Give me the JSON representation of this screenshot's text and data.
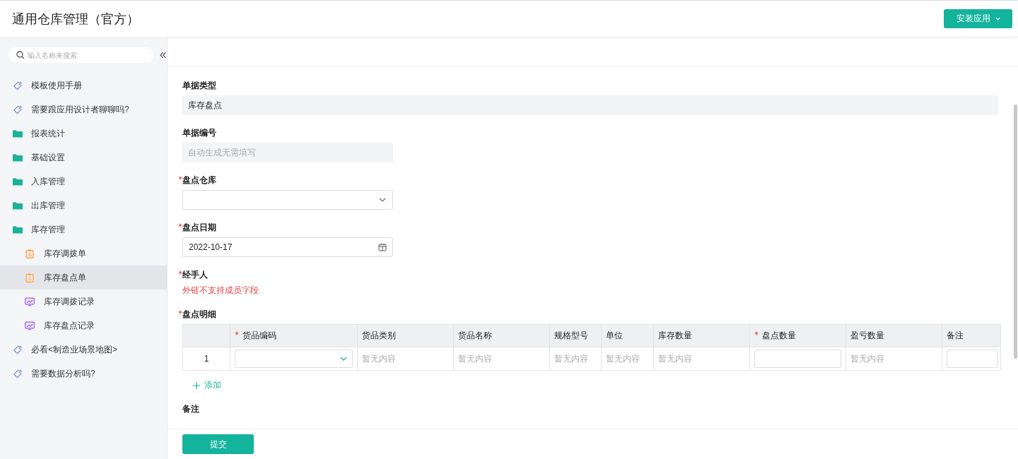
{
  "header": {
    "title": "通用仓库管理（官方）",
    "install_button": "安装应用"
  },
  "sidebar": {
    "search_placeholder": "输入名称来搜索",
    "items": [
      {
        "kind": "tag",
        "label": "模板使用手册",
        "selected": false
      },
      {
        "kind": "tag",
        "label": "需要跟应用设计者聊聊吗?",
        "selected": false
      },
      {
        "kind": "folder",
        "label": "报表统计",
        "selected": false
      },
      {
        "kind": "folder",
        "label": "基础设置",
        "selected": false
      },
      {
        "kind": "folder",
        "label": "入库管理",
        "selected": false
      },
      {
        "kind": "folder",
        "label": "出库管理",
        "selected": false
      },
      {
        "kind": "folder",
        "label": "库存管理",
        "selected": false,
        "children": [
          {
            "kind": "form",
            "label": "库存调拨单",
            "selected": false
          },
          {
            "kind": "form",
            "label": "库存盘点单",
            "selected": true
          },
          {
            "kind": "report",
            "label": "库存调拨记录",
            "selected": false
          },
          {
            "kind": "report",
            "label": "库存盘点记录",
            "selected": false
          }
        ]
      },
      {
        "kind": "tag",
        "label": "必看<制造业场景地图>",
        "selected": false
      },
      {
        "kind": "tag",
        "label": "需要数据分析吗?",
        "selected": false
      }
    ]
  },
  "form": {
    "fields": [
      {
        "kind": "readonly",
        "label": "单据类型",
        "required": false,
        "value": "库存盘点",
        "wide": true
      },
      {
        "kind": "readonly",
        "label": "单据编号",
        "required": false,
        "placeholder": "自动生成无需填写",
        "wide": false
      },
      {
        "kind": "select",
        "label": "盘点仓库",
        "required": true
      },
      {
        "kind": "date",
        "label": "盘点日期",
        "required": true,
        "value": "2022-10-17"
      },
      {
        "kind": "notice",
        "label": "经手人",
        "required": true,
        "value": "外链不支持成员字段"
      },
      {
        "kind": "table",
        "label": "盘点明细",
        "required": true,
        "columns": [
          {},
          {
            "label": "货品编码",
            "required": true
          },
          {
            "label": "货品类别",
            "required": false
          },
          {
            "label": "货品名称",
            "required": false
          },
          {
            "label": "规格型号",
            "required": false
          },
          {
            "label": "单位",
            "required": false
          },
          {
            "label": "库存数量",
            "required": false
          },
          {
            "label": "盘点数量",
            "required": true
          },
          {
            "label": "盈亏数量",
            "required": false
          },
          {
            "label": "备注",
            "required": false
          }
        ],
        "rows": [
          {
            "cells": [
              {
                "kind": "index",
                "text": "1"
              },
              {
                "kind": "select"
              },
              {
                "kind": "empty",
                "text": "暂无内容"
              },
              {
                "kind": "empty",
                "text": "暂无内容"
              },
              {
                "kind": "empty",
                "text": "暂无内容"
              },
              {
                "kind": "empty",
                "text": "暂无内容"
              },
              {
                "kind": "empty",
                "text": "暂无内容"
              },
              {
                "kind": "input"
              },
              {
                "kind": "empty",
                "text": "暂无内容"
              },
              {
                "kind": "input"
              }
            ]
          }
        ],
        "add_label": "添加"
      },
      {
        "kind": "heading",
        "label": "备注",
        "required": false
      }
    ],
    "submit": "提交"
  }
}
